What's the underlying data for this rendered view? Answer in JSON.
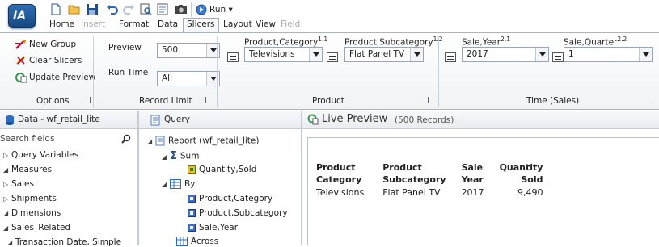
{
  "app": {
    "logo_text": "IA"
  },
  "tabs": [
    {
      "label": "Home",
      "state": "normal"
    },
    {
      "label": "Insert",
      "state": "disabled"
    },
    {
      "label": "Format",
      "state": "normal"
    },
    {
      "label": "Data",
      "state": "normal"
    },
    {
      "label": "Slicers",
      "state": "active"
    },
    {
      "label": "Layout",
      "state": "normal"
    },
    {
      "label": "View",
      "state": "normal"
    },
    {
      "label": "Field",
      "state": "disabled"
    }
  ],
  "quick_access": {
    "run_label": "Run ▾"
  },
  "ribbon": {
    "options": {
      "new_group": "New Group",
      "clear_slicers": "Clear Slicers",
      "update_preview": "Update Preview",
      "group_label": "Options"
    },
    "record_limit": {
      "preview_label": "Preview",
      "preview_value": "500",
      "run_time_label": "Run Time",
      "run_time_value": "All",
      "group_label": "Record Limit"
    },
    "product": {
      "category_label": "Product,Category",
      "category_sup": "1.1",
      "category_value": "Televisions",
      "subcategory_label": "Product,Subcategory",
      "subcategory_sup": "1.2",
      "subcategory_value": "Flat Panel TV",
      "group_label": "Product"
    },
    "time": {
      "year_label": "Sale,Year",
      "year_sup": "2.1",
      "year_value": "2017",
      "quarter_label": "Sale,Quarter",
      "quarter_sup": "2.2",
      "quarter_value": "1",
      "group_label": "Time (Sales)"
    }
  },
  "data_panel": {
    "title": "Data - wf_retail_lite",
    "search_placeholder": "Search fields",
    "items": [
      {
        "label": "Query Variables",
        "expanded": false
      },
      {
        "label": "Measures",
        "expanded": true
      },
      {
        "label": "Sales",
        "expanded": false
      },
      {
        "label": "Shipments",
        "expanded": false
      },
      {
        "label": "Dimensions",
        "expanded": true
      },
      {
        "label": "Sales_Related",
        "expanded": true
      },
      {
        "label": "Transaction Date, Simple",
        "expanded": true
      }
    ]
  },
  "query_panel": {
    "title": "Query",
    "report": "Report (wf_retail_lite)",
    "sum": "Sum",
    "sum_fields": [
      "Quantity,Sold"
    ],
    "by": "By",
    "by_fields": [
      "Product,Category",
      "Product,Subcategory",
      "Sale,Year"
    ],
    "across": "Across"
  },
  "preview": {
    "title": "Live Preview",
    "records": "(500 Records)",
    "headers": [
      [
        "Product",
        "Category"
      ],
      [
        "Product",
        "Subcategory"
      ],
      [
        "Sale",
        "Year"
      ],
      [
        "Quantity",
        "Sold"
      ]
    ],
    "rows": [
      [
        "Televisions",
        "Flat Panel TV",
        "2017",
        "9,490"
      ]
    ]
  }
}
